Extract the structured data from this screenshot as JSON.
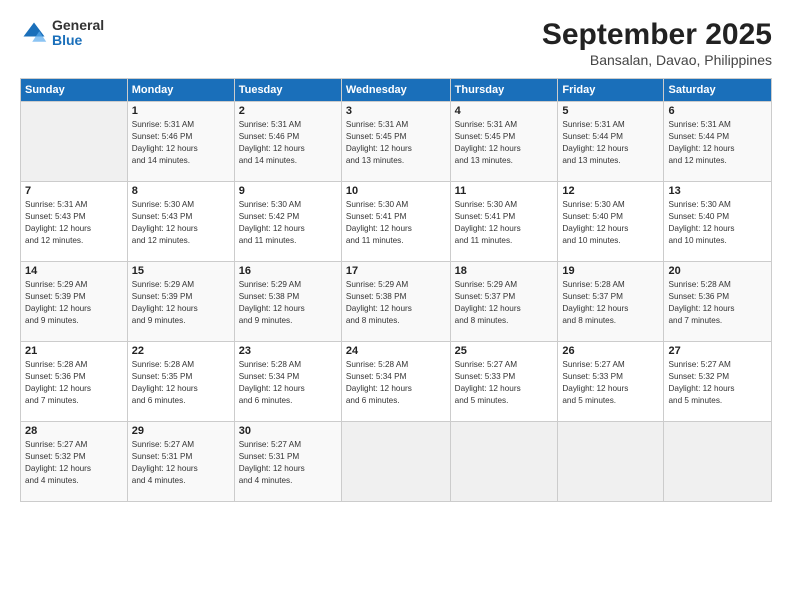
{
  "logo": {
    "general": "General",
    "blue": "Blue"
  },
  "title": "September 2025",
  "subtitle": "Bansalan, Davao, Philippines",
  "days_header": [
    "Sunday",
    "Monday",
    "Tuesday",
    "Wednesday",
    "Thursday",
    "Friday",
    "Saturday"
  ],
  "weeks": [
    [
      {
        "day": "",
        "info": ""
      },
      {
        "day": "1",
        "info": "Sunrise: 5:31 AM\nSunset: 5:46 PM\nDaylight: 12 hours\nand 14 minutes."
      },
      {
        "day": "2",
        "info": "Sunrise: 5:31 AM\nSunset: 5:46 PM\nDaylight: 12 hours\nand 14 minutes."
      },
      {
        "day": "3",
        "info": "Sunrise: 5:31 AM\nSunset: 5:45 PM\nDaylight: 12 hours\nand 13 minutes."
      },
      {
        "day": "4",
        "info": "Sunrise: 5:31 AM\nSunset: 5:45 PM\nDaylight: 12 hours\nand 13 minutes."
      },
      {
        "day": "5",
        "info": "Sunrise: 5:31 AM\nSunset: 5:44 PM\nDaylight: 12 hours\nand 13 minutes."
      },
      {
        "day": "6",
        "info": "Sunrise: 5:31 AM\nSunset: 5:44 PM\nDaylight: 12 hours\nand 12 minutes."
      }
    ],
    [
      {
        "day": "7",
        "info": "Sunrise: 5:31 AM\nSunset: 5:43 PM\nDaylight: 12 hours\nand 12 minutes."
      },
      {
        "day": "8",
        "info": "Sunrise: 5:30 AM\nSunset: 5:43 PM\nDaylight: 12 hours\nand 12 minutes."
      },
      {
        "day": "9",
        "info": "Sunrise: 5:30 AM\nSunset: 5:42 PM\nDaylight: 12 hours\nand 11 minutes."
      },
      {
        "day": "10",
        "info": "Sunrise: 5:30 AM\nSunset: 5:41 PM\nDaylight: 12 hours\nand 11 minutes."
      },
      {
        "day": "11",
        "info": "Sunrise: 5:30 AM\nSunset: 5:41 PM\nDaylight: 12 hours\nand 11 minutes."
      },
      {
        "day": "12",
        "info": "Sunrise: 5:30 AM\nSunset: 5:40 PM\nDaylight: 12 hours\nand 10 minutes."
      },
      {
        "day": "13",
        "info": "Sunrise: 5:30 AM\nSunset: 5:40 PM\nDaylight: 12 hours\nand 10 minutes."
      }
    ],
    [
      {
        "day": "14",
        "info": "Sunrise: 5:29 AM\nSunset: 5:39 PM\nDaylight: 12 hours\nand 9 minutes."
      },
      {
        "day": "15",
        "info": "Sunrise: 5:29 AM\nSunset: 5:39 PM\nDaylight: 12 hours\nand 9 minutes."
      },
      {
        "day": "16",
        "info": "Sunrise: 5:29 AM\nSunset: 5:38 PM\nDaylight: 12 hours\nand 9 minutes."
      },
      {
        "day": "17",
        "info": "Sunrise: 5:29 AM\nSunset: 5:38 PM\nDaylight: 12 hours\nand 8 minutes."
      },
      {
        "day": "18",
        "info": "Sunrise: 5:29 AM\nSunset: 5:37 PM\nDaylight: 12 hours\nand 8 minutes."
      },
      {
        "day": "19",
        "info": "Sunrise: 5:28 AM\nSunset: 5:37 PM\nDaylight: 12 hours\nand 8 minutes."
      },
      {
        "day": "20",
        "info": "Sunrise: 5:28 AM\nSunset: 5:36 PM\nDaylight: 12 hours\nand 7 minutes."
      }
    ],
    [
      {
        "day": "21",
        "info": "Sunrise: 5:28 AM\nSunset: 5:36 PM\nDaylight: 12 hours\nand 7 minutes."
      },
      {
        "day": "22",
        "info": "Sunrise: 5:28 AM\nSunset: 5:35 PM\nDaylight: 12 hours\nand 6 minutes."
      },
      {
        "day": "23",
        "info": "Sunrise: 5:28 AM\nSunset: 5:34 PM\nDaylight: 12 hours\nand 6 minutes."
      },
      {
        "day": "24",
        "info": "Sunrise: 5:28 AM\nSunset: 5:34 PM\nDaylight: 12 hours\nand 6 minutes."
      },
      {
        "day": "25",
        "info": "Sunrise: 5:27 AM\nSunset: 5:33 PM\nDaylight: 12 hours\nand 5 minutes."
      },
      {
        "day": "26",
        "info": "Sunrise: 5:27 AM\nSunset: 5:33 PM\nDaylight: 12 hours\nand 5 minutes."
      },
      {
        "day": "27",
        "info": "Sunrise: 5:27 AM\nSunset: 5:32 PM\nDaylight: 12 hours\nand 5 minutes."
      }
    ],
    [
      {
        "day": "28",
        "info": "Sunrise: 5:27 AM\nSunset: 5:32 PM\nDaylight: 12 hours\nand 4 minutes."
      },
      {
        "day": "29",
        "info": "Sunrise: 5:27 AM\nSunset: 5:31 PM\nDaylight: 12 hours\nand 4 minutes."
      },
      {
        "day": "30",
        "info": "Sunrise: 5:27 AM\nSunset: 5:31 PM\nDaylight: 12 hours\nand 4 minutes."
      },
      {
        "day": "",
        "info": ""
      },
      {
        "day": "",
        "info": ""
      },
      {
        "day": "",
        "info": ""
      },
      {
        "day": "",
        "info": ""
      }
    ]
  ]
}
